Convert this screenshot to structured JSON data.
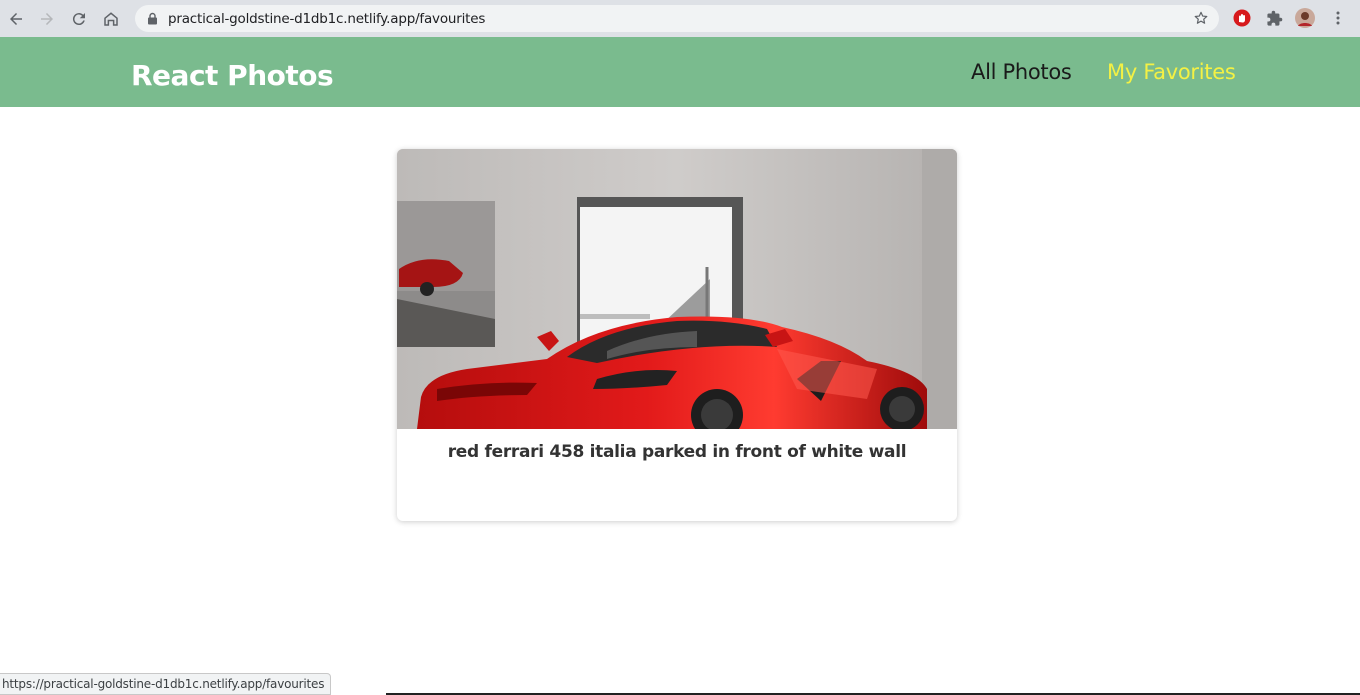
{
  "browser": {
    "url": "practical-goldstine-d1db1c.netlify.app/favourites",
    "status_url": "https://practical-goldstine-d1db1c.netlify.app/favourites"
  },
  "header": {
    "brand": "React Photos",
    "nav": {
      "all_photos": "All Photos",
      "my_favorites": "My Favorites"
    }
  },
  "favorites": [
    {
      "caption": "red ferrari 458 italia parked in front of white wall"
    }
  ],
  "colors": {
    "header_bg": "#7abb8e",
    "active_link": "#f4f144",
    "brand_text": "#ffffff"
  }
}
